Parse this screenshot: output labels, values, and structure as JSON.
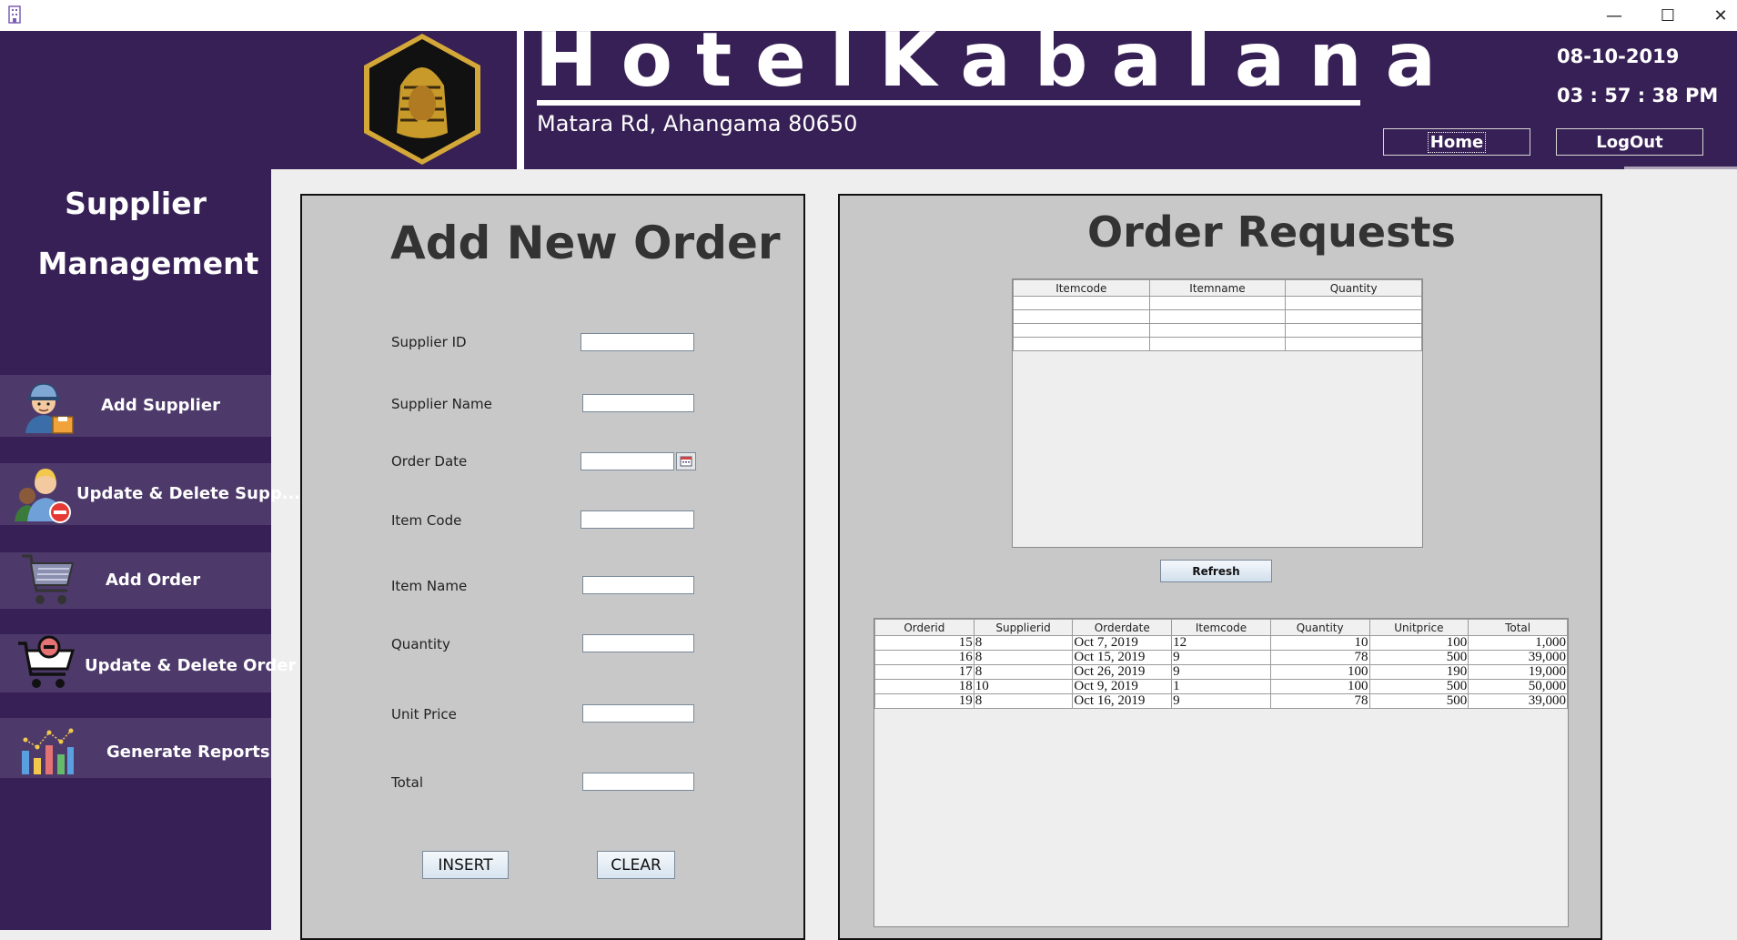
{
  "window": {
    "app_icon": "hotel-building-icon",
    "minimize_glyph": "—",
    "maximize_glyph": "☐",
    "close_glyph": "✕"
  },
  "header": {
    "logo": "pharaoh-logo-icon",
    "hotel_name": "HotelKabalana",
    "address": "Matara Rd, Ahangama 80650",
    "date": "08-10-2019",
    "time": "03 : 57 : 38 PM",
    "home_label": "Home",
    "logout_label": "LogOut"
  },
  "sidebar": {
    "title_line1": "Supplier",
    "title_line2": "Management",
    "items": [
      {
        "label": "Add Supplier",
        "icon": "delivery-man-icon"
      },
      {
        "label": "Update & Delete Supp...",
        "icon": "users-remove-icon"
      },
      {
        "label": "Add Order",
        "icon": "cart-icon"
      },
      {
        "label": "Update & Delete Order",
        "icon": "cart-remove-icon"
      },
      {
        "label": "Generate Reports",
        "icon": "bar-chart-icon"
      }
    ]
  },
  "add_order": {
    "title": "Add New Order",
    "fields": {
      "supplier_id": {
        "label": "Supplier ID",
        "value": ""
      },
      "supplier_name": {
        "label": "Supplier Name",
        "value": ""
      },
      "order_date": {
        "label": "Order Date",
        "value": ""
      },
      "item_code": {
        "label": "Item Code",
        "value": ""
      },
      "item_name": {
        "label": "Item Name",
        "value": ""
      },
      "quantity": {
        "label": "Quantity",
        "value": ""
      },
      "unit_price": {
        "label": "Unit Price",
        "value": ""
      },
      "total": {
        "label": "Total",
        "value": ""
      }
    },
    "insert_label": "INSERT",
    "clear_label": "CLEAR"
  },
  "order_requests": {
    "title": "Order Requests",
    "requests_table": {
      "columns": [
        "Itemcode",
        "Itemname",
        "Quantity"
      ],
      "rows": [
        [
          "",
          "",
          ""
        ],
        [
          "",
          "",
          ""
        ],
        [
          "",
          "",
          ""
        ],
        [
          "",
          "",
          ""
        ]
      ]
    },
    "refresh_label": "Refresh",
    "orders_table": {
      "columns": [
        "Orderid",
        "Supplierid",
        "Orderdate",
        "Itemcode",
        "Quantity",
        "Unitprice",
        "Total"
      ],
      "rows": [
        [
          "15",
          "8",
          "Oct 7, 2019",
          "12",
          "10",
          "100",
          "1,000"
        ],
        [
          "16",
          "8",
          "Oct 15, 2019",
          "9",
          "78",
          "500",
          "39,000"
        ],
        [
          "17",
          "8",
          "Oct 26, 2019",
          "9",
          "100",
          "190",
          "19,000"
        ],
        [
          "18",
          "10",
          "Oct 9, 2019",
          "1",
          "100",
          "500",
          "50,000"
        ],
        [
          "19",
          "8",
          "Oct 16, 2019",
          "9",
          "78",
          "500",
          "39,000"
        ]
      ]
    }
  }
}
